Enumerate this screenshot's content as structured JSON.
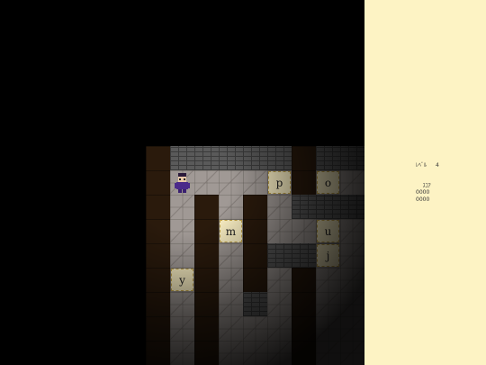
{
  "tiles": [
    {
      "letter": "p"
    },
    {
      "letter": "o"
    },
    {
      "letter": "m"
    },
    {
      "letter": "u"
    },
    {
      "letter": "j"
    },
    {
      "letter": "y"
    }
  ],
  "panel": {
    "stats": [
      {
        "label": "ﾚﾍﾞﾙ",
        "value": "4"
      },
      {
        "label": "ｽｺｱ\n0000",
        "value": ""
      },
      {
        "label": "0000",
        "value": ""
      }
    ]
  },
  "colors": {
    "panel_bg": "#fdf3c4",
    "tile_bg": "#fbf0c4",
    "floor": "#a09995",
    "wall": "#2a1a0c",
    "player": "#4b2a8a"
  },
  "icons": {
    "player": "character-sprite-icon"
  }
}
